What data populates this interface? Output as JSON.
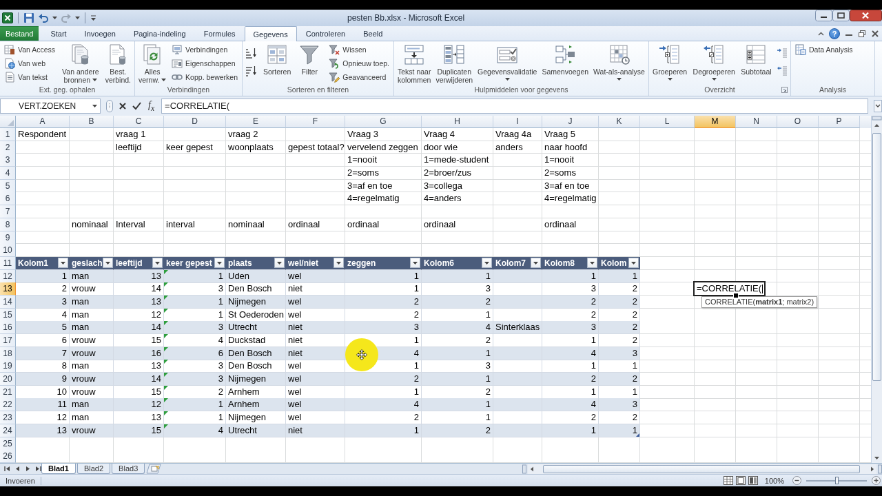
{
  "title_bar": {
    "title": "pesten Bb.xlsx - Microsoft Excel"
  },
  "ribbon": {
    "tabs": [
      {
        "label": "Bestand",
        "kind": "file",
        "selected": false
      },
      {
        "label": "Start",
        "kind": "tab",
        "selected": false
      },
      {
        "label": "Invoegen",
        "kind": "tab",
        "selected": false
      },
      {
        "label": "Pagina-indeling",
        "kind": "tab",
        "selected": false
      },
      {
        "label": "Formules",
        "kind": "tab",
        "selected": false
      },
      {
        "label": "Gegevens",
        "kind": "tab",
        "selected": true
      },
      {
        "label": "Controleren",
        "kind": "tab",
        "selected": false
      },
      {
        "label": "Beeld",
        "kind": "tab",
        "selected": false
      }
    ],
    "help_button": "?",
    "groups": [
      {
        "label": "Ext. geg. ophalen",
        "commands": [
          {
            "kind": "stack",
            "items": [
              {
                "label": "Van Access"
              },
              {
                "label": "Van web"
              },
              {
                "label": "Van tekst"
              }
            ]
          },
          {
            "kind": "large",
            "label": "Van andere\nbronnen",
            "dropdown": true
          },
          {
            "kind": "large",
            "label": "Best.\nverbind.",
            "dropdown": false
          }
        ]
      },
      {
        "label": "Verbindingen",
        "commands": [
          {
            "kind": "large",
            "label": "Alles\nvernw.",
            "dropdown": true
          },
          {
            "kind": "stack",
            "items": [
              {
                "label": "Verbindingen"
              },
              {
                "label": "Eigenschappen"
              },
              {
                "label": "Kopp. bewerken"
              }
            ]
          }
        ]
      },
      {
        "label": "Sorteren en filteren",
        "commands": [
          {
            "kind": "sort_pair"
          },
          {
            "kind": "large",
            "label": "Sorteren",
            "dropdown": false
          },
          {
            "kind": "large",
            "label": "Filter",
            "dropdown": false
          },
          {
            "kind": "stack",
            "items": [
              {
                "label": "Wissen"
              },
              {
                "label": "Opnieuw toep."
              },
              {
                "label": "Geavanceerd"
              }
            ]
          }
        ]
      },
      {
        "label": "Hulpmiddelen voor gegevens",
        "commands": [
          {
            "kind": "large",
            "label": "Tekst naar\nkolommen",
            "dropdown": false
          },
          {
            "kind": "large",
            "label": "Duplicaten\nverwijderen",
            "dropdown": false
          },
          {
            "kind": "large",
            "label": "Gegevensvalidatie",
            "dropdown": true
          },
          {
            "kind": "large",
            "label": "Samenvoegen",
            "dropdown": false
          },
          {
            "kind": "large",
            "label": "Wat-als-analyse",
            "dropdown": true
          }
        ]
      },
      {
        "label": "Overzicht",
        "launcher": true,
        "commands": [
          {
            "kind": "large",
            "label": "Groeperen",
            "dropdown": true
          },
          {
            "kind": "large",
            "label": "Degroeperen",
            "dropdown": true
          },
          {
            "kind": "large",
            "label": "Subtotaal",
            "dropdown": false
          },
          {
            "kind": "detail_pair"
          }
        ]
      },
      {
        "label": "Analysis",
        "commands": [
          {
            "kind": "small",
            "label": "Data Analysis"
          }
        ]
      }
    ]
  },
  "formula_bar": {
    "name_box": "VERT.ZOEKEN",
    "function_button": "f$_{x}$",
    "formula": "=CORRELATIE("
  },
  "sheet": {
    "edit_mode": true,
    "function_tooltip": "CORRELATIE(**matrix1**; matrix2)",
    "columns": [
      {
        "label": "A",
        "selected": false
      },
      {
        "label": "B",
        "selected": false
      },
      {
        "label": "C",
        "selected": false
      },
      {
        "label": "D",
        "selected": false
      },
      {
        "label": "E",
        "selected": false
      },
      {
        "label": "F",
        "selected": false
      },
      {
        "label": "G",
        "selected": false
      },
      {
        "label": "H",
        "selected": false
      },
      {
        "label": "I",
        "selected": false
      },
      {
        "label": "J",
        "selected": false
      },
      {
        "label": "K",
        "selected": false
      },
      {
        "label": "L",
        "selected": false
      },
      {
        "label": "M",
        "selected": true
      },
      {
        "label": "N",
        "selected": false
      },
      {
        "label": "O",
        "selected": false
      },
      {
        "label": "P",
        "selected": false
      }
    ],
    "rows": [
      {
        "number": "1",
        "selected": false,
        "kind": "plain",
        "cells": [
          "Respondent",
          null,
          "vraag 1",
          null,
          "vraag 2",
          null,
          "Vraag 3",
          "Vraag 4",
          "Vraag 4a",
          "Vraag 5"
        ]
      },
      {
        "number": "2",
        "selected": false,
        "kind": "plain",
        "cells": [
          null,
          null,
          "leeftijd",
          "keer gepest",
          "woonplaats",
          "gepest totaal?",
          "vervelend zeggen",
          "door wie",
          "anders",
          "naar hoofd"
        ]
      },
      {
        "number": "3",
        "selected": false,
        "kind": "plain",
        "cells": [
          null,
          null,
          null,
          null,
          null,
          null,
          "1=nooit",
          "1=mede-student",
          null,
          "1=nooit"
        ]
      },
      {
        "number": "4",
        "selected": false,
        "kind": "plain",
        "cells": [
          null,
          null,
          null,
          null,
          null,
          null,
          "2=soms",
          "2=broer/zus",
          null,
          "2=soms"
        ]
      },
      {
        "number": "5",
        "selected": false,
        "kind": "plain",
        "cells": [
          null,
          null,
          null,
          null,
          null,
          null,
          "3=af en toe",
          "3=collega",
          null,
          "3=af en toe"
        ]
      },
      {
        "number": "6",
        "selected": false,
        "kind": "plain",
        "cells": [
          null,
          null,
          null,
          null,
          null,
          null,
          "4=regelmatig",
          "4=anders",
          null,
          "4=regelmatig"
        ]
      },
      {
        "number": "7",
        "selected": false,
        "kind": "plain"
      },
      {
        "number": "8",
        "selected": false,
        "kind": "plain",
        "cells": [
          null,
          "nominaal",
          "Interval",
          "interval",
          "nominaal",
          "ordinaal",
          "ordinaal",
          "ordinaal",
          null,
          "ordinaal"
        ]
      },
      {
        "number": "9",
        "selected": false,
        "kind": "plain"
      },
      {
        "number": "10",
        "selected": false,
        "kind": "plain"
      },
      {
        "number": "11",
        "selected": false,
        "kind": "table_header",
        "filter_buttons": true,
        "cells": [
          "Kolom1",
          "geslach",
          "leeftijd",
          "keer gepest",
          "plaats",
          "wel/niet",
          "zeggen",
          "Kolom6",
          "Kolom7",
          "Kolom8",
          "Kolom"
        ]
      },
      {
        "number": "12",
        "selected": false,
        "kind": "table_row",
        "shaded": true,
        "cells": [
          "1",
          "man",
          "13",
          {
            "value": "1",
            "error_indicator": true
          },
          "Uden",
          "wel",
          "1",
          "1",
          null,
          "1",
          "1"
        ]
      },
      {
        "number": "13",
        "selected": true,
        "kind": "table_row",
        "shaded": false,
        "cells": [
          "2",
          "vrouw",
          "14",
          {
            "value": "3",
            "error_indicator": true
          },
          "Den Bosch",
          "niet",
          "1",
          "3",
          null,
          "3",
          "2",
          null,
          "=CORRELATIE("
        ]
      },
      {
        "number": "14",
        "selected": false,
        "kind": "table_row",
        "shaded": true,
        "cells": [
          "3",
          "man",
          "13",
          {
            "value": "1",
            "error_indicator": true
          },
          "Nijmegen",
          "wel",
          "2",
          "2",
          null,
          "2",
          "2"
        ]
      },
      {
        "number": "15",
        "selected": false,
        "kind": "table_row",
        "shaded": false,
        "cells": [
          "4",
          "man",
          "12",
          {
            "value": "1",
            "error_indicator": true
          },
          "St Oederoden",
          "wel",
          "2",
          "1",
          null,
          "2",
          "2"
        ]
      },
      {
        "number": "16",
        "selected": false,
        "kind": "table_row",
        "shaded": true,
        "cells": [
          "5",
          "man",
          "14",
          {
            "value": "3",
            "error_indicator": true
          },
          "Utrecht",
          "niet",
          "3",
          "4",
          "Sinterklaas",
          "3",
          "2"
        ]
      },
      {
        "number": "17",
        "selected": false,
        "kind": "table_row",
        "shaded": false,
        "cells": [
          "6",
          "vrouw",
          "15",
          {
            "value": "4",
            "error_indicator": true
          },
          "Duckstad",
          "niet",
          "1",
          "2",
          null,
          "1",
          "2"
        ]
      },
      {
        "number": "18",
        "selected": false,
        "kind": "table_row",
        "shaded": true,
        "cells": [
          "7",
          "vrouw",
          "16",
          {
            "value": "6",
            "error_indicator": true
          },
          "Den Bosch",
          "niet",
          "4",
          "1",
          null,
          "4",
          "3"
        ]
      },
      {
        "number": "19",
        "selected": false,
        "kind": "table_row",
        "shaded": false,
        "cells": [
          "8",
          "man",
          "13",
          {
            "value": "3",
            "error_indicator": true
          },
          "Den Bosch",
          "wel",
          "1",
          "3",
          null,
          "1",
          "1"
        ]
      },
      {
        "number": "20",
        "selected": false,
        "kind": "table_row",
        "shaded": true,
        "cells": [
          "9",
          "vrouw",
          "14",
          {
            "value": "3",
            "error_indicator": true
          },
          "Nijmegen",
          "wel",
          "2",
          "1",
          null,
          "2",
          "2"
        ]
      },
      {
        "number": "21",
        "selected": false,
        "kind": "table_row",
        "shaded": false,
        "cells": [
          "10",
          "vrouw",
          "15",
          {
            "value": "2",
            "error_indicator": true
          },
          "Arnhem",
          "wel",
          "1",
          "2",
          null,
          "1",
          "1"
        ]
      },
      {
        "number": "22",
        "selected": false,
        "kind": "table_row",
        "shaded": true,
        "cells": [
          "11",
          "man",
          "12",
          {
            "value": "1",
            "error_indicator": true
          },
          "Arnhem",
          "wel",
          "4",
          "1",
          null,
          "4",
          "3"
        ]
      },
      {
        "number": "23",
        "selected": false,
        "kind": "table_row",
        "shaded": false,
        "cells": [
          "12",
          "man",
          "13",
          {
            "value": "1",
            "error_indicator": true
          },
          "Nijmegen",
          "wel",
          "2",
          "1",
          null,
          "2",
          "2"
        ]
      },
      {
        "number": "24",
        "selected": false,
        "kind": "table_row",
        "shaded": true,
        "cells": [
          "13",
          "vrouw",
          "15",
          {
            "value": "4",
            "error_indicator": true
          },
          "Utrecht",
          "niet",
          "1",
          "2",
          null,
          "1",
          "1"
        ]
      },
      {
        "number": "25",
        "selected": false,
        "kind": "plain"
      },
      {
        "number": "26",
        "selected": false,
        "kind": "plain"
      }
    ]
  },
  "sheet_tabs": [
    {
      "label": "Blad1",
      "selected": true
    },
    {
      "label": "Blad2",
      "selected": false
    },
    {
      "label": "Blad3",
      "selected": false
    }
  ],
  "status_bar": {
    "mode": "Invoeren",
    "zoom": "100%",
    "zoom_slider": {
      "level": 0.5
    }
  }
}
